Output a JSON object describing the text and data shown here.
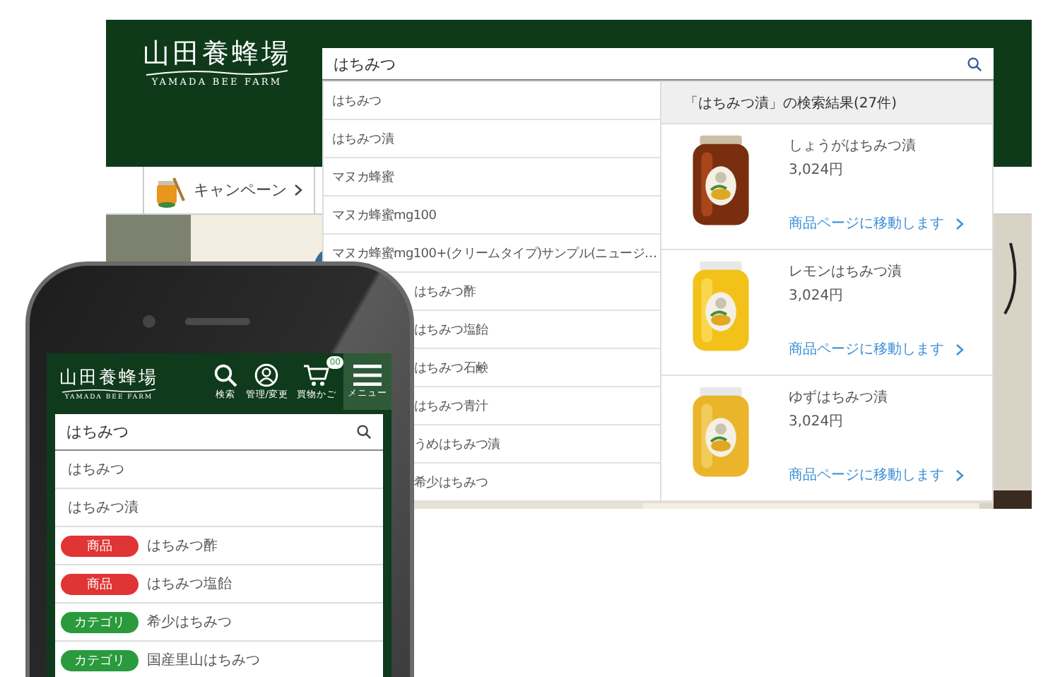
{
  "desktop": {
    "logo": {
      "title": "山田養蜂場",
      "subtitle": "YAMADA BEE FARM"
    },
    "nav": [
      {
        "label": "キャンペーン"
      }
    ],
    "search": {
      "value": "はちみつ"
    },
    "suggestions": [
      {
        "text": "はちみつ",
        "kind": "plain"
      },
      {
        "text": "はちみつ漬",
        "kind": "plain"
      },
      {
        "text": "マヌカ蜂蜜",
        "kind": "plain"
      },
      {
        "text": "マヌカ蜂蜜mg100",
        "kind": "plain"
      },
      {
        "text": "マヌカ蜂蜜mg100+(クリームタイプ)サンプル(ニュージ…",
        "kind": "plain"
      },
      {
        "text": "はちみつ酢",
        "kind": "tagged"
      },
      {
        "text": "はちみつ塩飴",
        "kind": "tagged"
      },
      {
        "text": "はちみつ石鹸",
        "kind": "tagged"
      },
      {
        "text": "はちみつ青汁",
        "kind": "tagged"
      },
      {
        "text": "うめはちみつ漬",
        "kind": "tagged"
      },
      {
        "text": "希少はちみつ",
        "kind": "tagged"
      }
    ],
    "results": {
      "title": "「はちみつ漬」の検索結果(27件)",
      "products": [
        {
          "name": "しょうがはちみつ漬",
          "price": "3,024円",
          "link": "商品ページに移動します"
        },
        {
          "name": "レモンはちみつ漬",
          "price": "3,024円",
          "link": "商品ページに移動します"
        },
        {
          "name": "ゆずはちみつ漬",
          "price": "3,024円",
          "link": "商品ページに移動します"
        }
      ]
    }
  },
  "phone": {
    "logo": {
      "title": "山田養蜂場",
      "subtitle": "YAMADA BEE FARM"
    },
    "header_buttons": [
      {
        "label": "検索",
        "kind": "search"
      },
      {
        "label": "管理/変更",
        "kind": "account"
      },
      {
        "label": "買物かご",
        "kind": "cart",
        "count": "00"
      },
      {
        "label": "メニュー",
        "kind": "menu"
      }
    ],
    "search": {
      "value": "はちみつ"
    },
    "suggestions": [
      {
        "text": "はちみつ"
      },
      {
        "text": "はちみつ漬"
      },
      {
        "tag": "商品",
        "color": "#e03535",
        "text": "はちみつ酢"
      },
      {
        "tag": "商品",
        "color": "#e03535",
        "text": "はちみつ塩飴"
      },
      {
        "tag": "カテゴリ",
        "color": "#2a9a3c",
        "text": "希少はちみつ"
      },
      {
        "tag": "カテゴリ",
        "color": "#2a9a3c",
        "text": "国産里山はちみつ"
      }
    ]
  }
}
